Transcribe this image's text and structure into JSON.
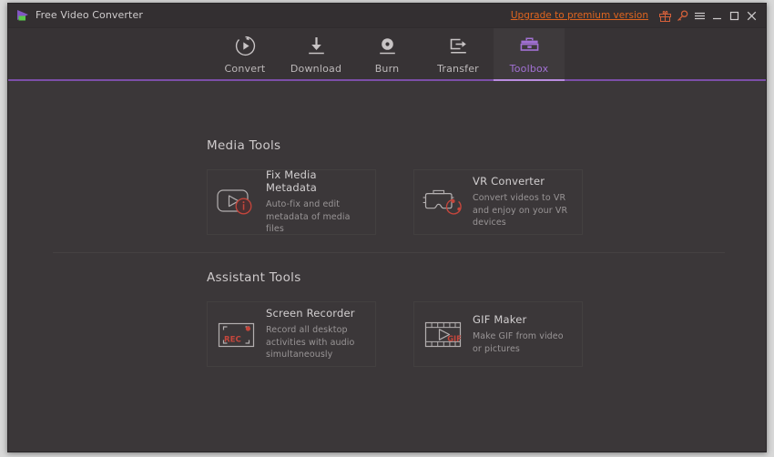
{
  "window": {
    "title": "Free Video Converter",
    "logo_icon": "play-logo-icon"
  },
  "titlebar": {
    "upgrade_label": "Upgrade to premium version",
    "icons": [
      {
        "name": "gift-icon",
        "label": "Gift"
      },
      {
        "name": "key-icon",
        "label": "Register"
      },
      {
        "name": "menu-icon",
        "label": "Menu"
      },
      {
        "name": "minimize-icon",
        "label": "Minimize"
      },
      {
        "name": "maximize-icon",
        "label": "Maximize"
      },
      {
        "name": "close-icon",
        "label": "Close"
      }
    ]
  },
  "nav": {
    "items": [
      {
        "label": "Convert",
        "icon": "convert-icon",
        "active": false
      },
      {
        "label": "Download",
        "icon": "download-icon",
        "active": false
      },
      {
        "label": "Burn",
        "icon": "burn-icon",
        "active": false
      },
      {
        "label": "Transfer",
        "icon": "transfer-icon",
        "active": false
      },
      {
        "label": "Toolbox",
        "icon": "toolbox-icon",
        "active": true
      }
    ]
  },
  "sections": [
    {
      "title": "Media Tools",
      "cards": [
        {
          "title": "Fix Media Metadata",
          "desc": "Auto-fix and edit metadata of media files",
          "icon": "fix-metadata-icon"
        },
        {
          "title": "VR Converter",
          "desc": "Convert videos to VR and enjoy on your VR devices",
          "icon": "vr-converter-icon"
        }
      ]
    },
    {
      "title": "Assistant Tools",
      "cards": [
        {
          "title": "Screen Recorder",
          "desc": "Record all desktop activities with audio simultaneously",
          "icon": "screen-recorder-icon"
        },
        {
          "title": "GIF Maker",
          "desc": "Make GIF from video or pictures",
          "icon": "gif-maker-icon"
        }
      ]
    }
  ],
  "colors": {
    "window_bg": "#3b3739",
    "titlebar_bg": "#332f31",
    "nav_bg": "#373335",
    "accent_purple": "#a271d4",
    "accent_underline": "#7c4fa8",
    "accent_orange": "#e0651f",
    "accent_red": "#c9483f",
    "text_primary": "#d2cfd0",
    "text_secondary": "#999596"
  }
}
